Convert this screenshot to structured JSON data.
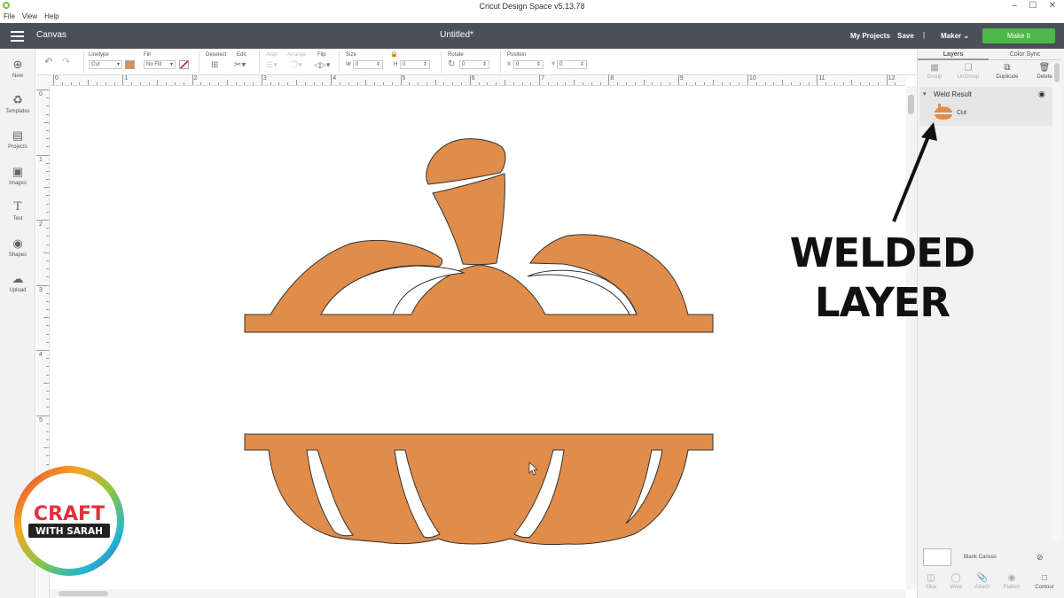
{
  "window": {
    "title": "Cricut Design Space  v5.13.78",
    "controls": [
      "–",
      "☐",
      "✕"
    ],
    "menu": [
      "File",
      "View",
      "Help"
    ]
  },
  "header": {
    "canvas_label": "Canvas",
    "doc_title": "Untitled*",
    "my_projects": "My Projects",
    "save": "Save",
    "separator": "|",
    "machine": "Maker",
    "make_it": "Make It"
  },
  "toolbar": {
    "linetype_label": "Linetype",
    "linetype_value": "Cut",
    "fill_label": "Fill",
    "fill_value": "No Fill",
    "deselect_label": "Deselect",
    "edit_label": "Edit",
    "align_label": "Align",
    "arrange_label": "Arrange",
    "flip_label": "Flip",
    "size_label": "Size",
    "w_label": "W",
    "w_value": "0",
    "h_label": "H",
    "h_value": "0",
    "rotate_label": "Rotate",
    "rotate_value": "0",
    "position_label": "Position",
    "x_label": "X",
    "x_value": "0",
    "y_label": "Y",
    "y_value": "0",
    "swatch_color": "#e08c4a"
  },
  "leftnav": [
    "New",
    "Templates",
    "Projects",
    "Images",
    "Text",
    "Shapes",
    "Upload"
  ],
  "ruler": {
    "top": [
      "0",
      "1",
      "2",
      "3",
      "4",
      "5",
      "6",
      "7",
      "8",
      "9",
      "10",
      "11",
      "12"
    ],
    "left": [
      "0",
      "1",
      "2",
      "3",
      "4",
      "5"
    ]
  },
  "panel": {
    "tab_layers": "Layers",
    "tab_colorsync": "Color Sync",
    "btn_group": "Group",
    "btn_ungroup": "UnGroup",
    "btn_duplicate": "Duplicate",
    "btn_delete": "Delete",
    "layer_group": "Weld Result",
    "layer_item": "Cut",
    "blank_canvas": "Blank Canvas",
    "bottom": [
      "Slice",
      "Weld",
      "Attach",
      "Flatten",
      "Contour"
    ]
  },
  "annotation": {
    "line1": "WELDED",
    "line2": "LAYER"
  },
  "logo": {
    "word1": "CRAFT",
    "word2": "WITH SARAH"
  },
  "colors": {
    "pumpkin_fill": "#e08c4a",
    "header_bg": "#4a5057",
    "make_it_green": "#4cb848"
  }
}
